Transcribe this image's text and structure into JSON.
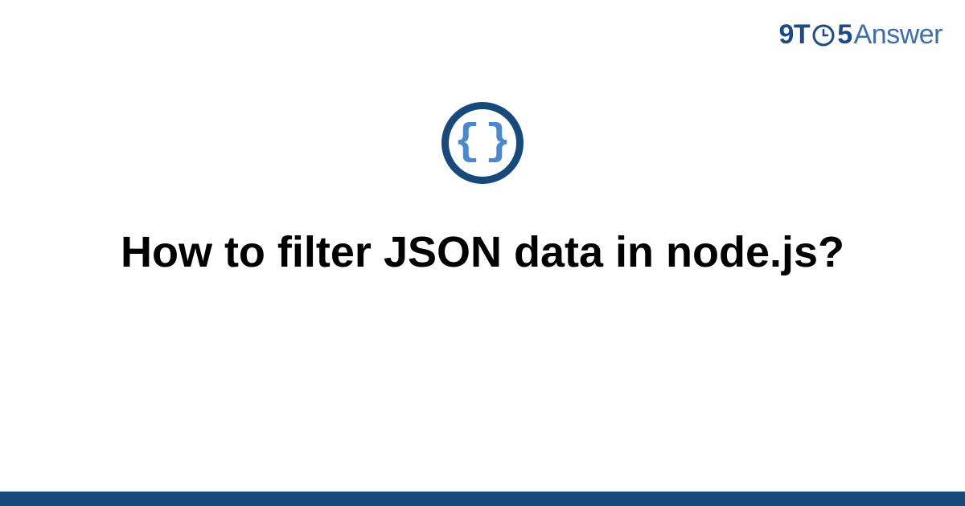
{
  "brand": {
    "prefix": "9T",
    "middle": "5",
    "suffix": "Answer"
  },
  "icon": {
    "left_brace": "{",
    "right_brace": "}"
  },
  "title": "How to filter JSON data in node.js?"
}
